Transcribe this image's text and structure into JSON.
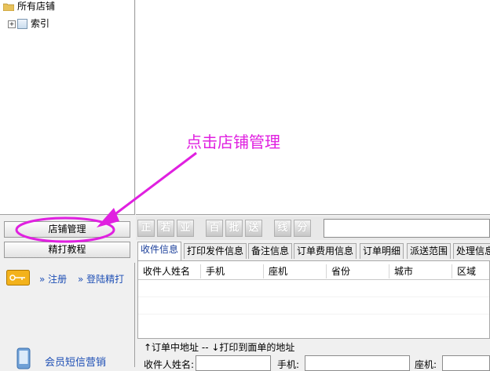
{
  "tree": {
    "root_label": "所有店铺",
    "child_label": "索引"
  },
  "left_buttons": {
    "store_manage": "店铺管理",
    "tutorial": "精打教程"
  },
  "account": {
    "register": "注册",
    "login": "登陆精打"
  },
  "sms_marketing": "会员短信营销",
  "toolbar": {
    "buttons": [
      "正",
      "若",
      "亚",
      "百",
      "批",
      "送",
      "线",
      "分"
    ]
  },
  "tabs": [
    "收件信息",
    "打印发件信息",
    "备注信息",
    "订单费用信息",
    "订单明细",
    "派送范围",
    "处理信息"
  ],
  "active_tab": 0,
  "columns": [
    "收件人姓名",
    "手机",
    "座机",
    "省份",
    "城市",
    "区域"
  ],
  "address_bar": {
    "legend": "↑订单中地址  -- ↓打印到面单的地址",
    "name_label": "收件人姓名:",
    "mobile_label": "手机:",
    "phone_label": "座机:"
  },
  "annotation": {
    "text": "点击店铺管理",
    "color": "#e020e0"
  }
}
